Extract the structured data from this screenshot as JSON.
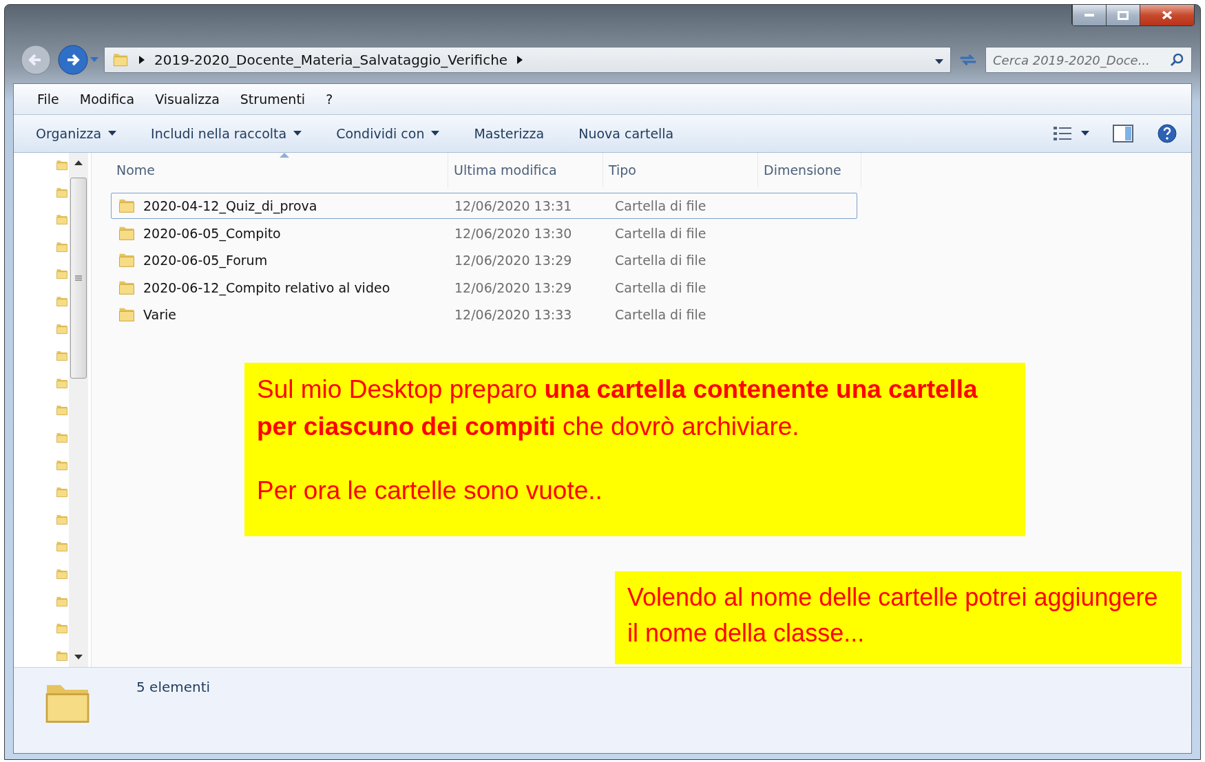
{
  "address": {
    "path": "2019-2020_Docente_Materia_Salvataggio_Verifiche"
  },
  "search": {
    "placeholder": "Cerca 2019-2020_Doce..."
  },
  "menu": [
    {
      "label": "File"
    },
    {
      "label": "Modifica"
    },
    {
      "label": "Visualizza"
    },
    {
      "label": "Strumenti"
    },
    {
      "label": "?"
    }
  ],
  "toolbar": [
    {
      "label": "Organizza",
      "has_menu": true
    },
    {
      "label": "Includi nella raccolta",
      "has_menu": true
    },
    {
      "label": "Condividi con",
      "has_menu": true
    },
    {
      "label": "Masterizza",
      "has_menu": false
    },
    {
      "label": "Nuova cartella",
      "has_menu": false
    }
  ],
  "columns": [
    {
      "label": "Nome",
      "sorted": true
    },
    {
      "label": "Ultima modifica",
      "sorted": false
    },
    {
      "label": "Tipo",
      "sorted": false
    },
    {
      "label": "Dimensione",
      "sorted": false
    }
  ],
  "rows": [
    {
      "name": "2020-04-12_Quiz_di_prova",
      "modified": "12/06/2020 13:31",
      "type": "Cartella di file",
      "focused": true
    },
    {
      "name": "2020-06-05_Compito",
      "modified": "12/06/2020 13:30",
      "type": "Cartella di file",
      "focused": false
    },
    {
      "name": "2020-06-05_Forum",
      "modified": "12/06/2020 13:29",
      "type": "Cartella di file",
      "focused": false
    },
    {
      "name": "2020-06-12_Compito relativo al video",
      "modified": "12/06/2020 13:29",
      "type": "Cartella di file",
      "focused": false
    },
    {
      "name": "Varie",
      "modified": "12/06/2020 13:33",
      "type": "Cartella di file",
      "focused": false
    }
  ],
  "status_bar": {
    "text": "5 elementi"
  },
  "callouts": [
    {
      "paragraphs": [
        "Sul mio Desktop preparo **una cartella contenente una cartella per ciascuno dei compiti** che dovrò archiviare.",
        "Per ora le cartelle sono vuote.."
      ]
    },
    {
      "paragraphs": [
        "Volendo al nome delle cartelle potrei aggiungere il nome della classe..."
      ]
    }
  ]
}
